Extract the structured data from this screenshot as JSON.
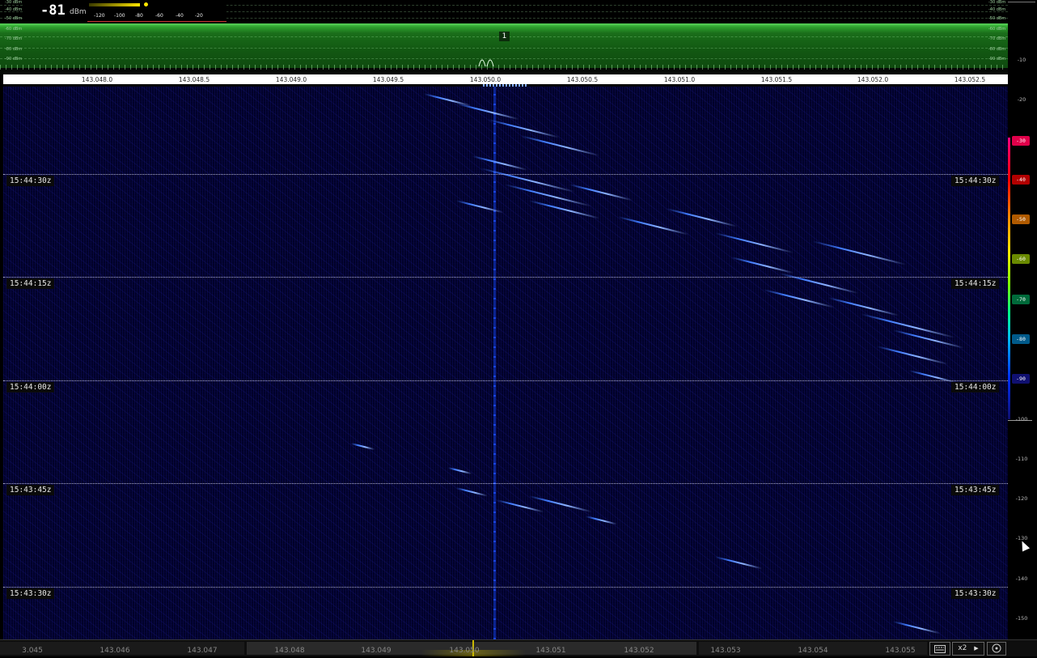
{
  "meter": {
    "value": "-81",
    "unit": "dBm",
    "level_dbm": -81,
    "scale": [
      "-120",
      "-100",
      "-80",
      "-60",
      "-40",
      "-20"
    ]
  },
  "spectrum": {
    "level_labels_left": [
      "-30 dBm",
      "-40 dBm",
      "-50 dBm",
      "-60 dBm",
      "-70 dBm",
      "-80 dBm",
      "-90 dBm"
    ],
    "level_labels_right": [
      "-30 dBm",
      "-40 dBm",
      "-50 dBm",
      "-60 dBm",
      "-70 dBm",
      "-80 dBm",
      "-90 dBm"
    ],
    "marker_label": "1",
    "accent_color": "#2fa32f"
  },
  "freq_axis": {
    "ticks": [
      "143.048.0",
      "143.048.5",
      "143.049.0",
      "143.049.5",
      "143.050.0",
      "143.050.5",
      "143.051.0",
      "143.051.5",
      "143.052.0",
      "143.052.5"
    ]
  },
  "waterfall": {
    "time_labels": [
      "15:44:30z",
      "15:44:15z",
      "15:44:00z",
      "15:43:45z",
      "15:43:30z"
    ],
    "background_color": "#00001f",
    "signal_color": "#3f7bff"
  },
  "color_scale": {
    "labels": [
      "-10",
      "-20",
      "-30",
      "-40",
      "-50",
      "-60",
      "-70",
      "-80",
      "-90",
      "-100",
      "-110",
      "-120",
      "-130",
      "-140",
      "-150"
    ],
    "chip_labels": [
      "-30",
      "-40",
      "-50",
      "-60",
      "-70",
      "-80",
      "-90"
    ]
  },
  "bottom_bar": {
    "ticks": [
      "3.045",
      "143.046",
      "143.047",
      "143.048",
      "143.049",
      "143.050",
      "143.051",
      "143.052",
      "143.053",
      "143.054",
      "143.055"
    ],
    "zoom_label": "x2"
  }
}
